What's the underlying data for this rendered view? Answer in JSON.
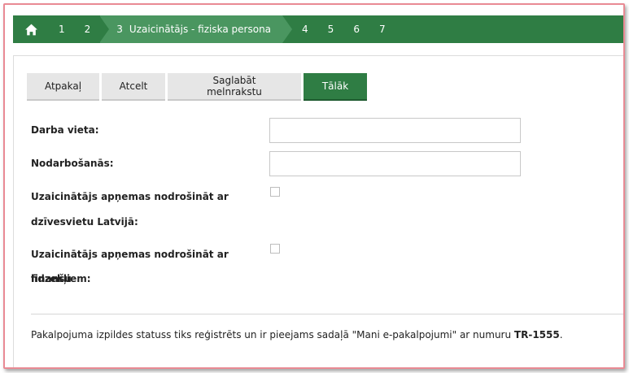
{
  "steps": {
    "home_icon": "home-icon",
    "items": [
      {
        "number": "1",
        "label": ""
      },
      {
        "number": "2",
        "label": ""
      },
      {
        "number": "3",
        "label": "Uzaicinātājs - fiziska persona"
      },
      {
        "number": "4",
        "label": ""
      },
      {
        "number": "5",
        "label": ""
      },
      {
        "number": "6",
        "label": ""
      },
      {
        "number": "7",
        "label": ""
      }
    ],
    "active_index": 2
  },
  "toolbar": {
    "back_label": "Atpakaļ",
    "cancel_label": "Atcelt",
    "save_draft_label": "Saglabāt melnrakstu",
    "next_label": "Tālāk"
  },
  "form": {
    "workplace_label": "Darba vieta:",
    "workplace_value": "",
    "occupation_label": "Nodarbošanās:",
    "occupation_value": "",
    "residence_line1": "Uzaicinātājs apņemas nodrošināt ar",
    "residence_line2": "dzīvesvietu Latvijā:",
    "residence_checked": false,
    "finance_line1": "Uzaicinātājs apņemas nodrošināt ar finanšu",
    "finance_line2": "līdzekļiem:",
    "finance_checked": false
  },
  "footer": {
    "note_text": "Pakalpojuma izpildes statuss tiks reģistrēts un ir pieejams sadaļā \"Mani e-pakalpojumi\" ar numuru ",
    "reference_number": "TR-1555",
    "note_end": "."
  },
  "colors": {
    "brand_green": "#2f7d44",
    "active_step": "#4a9660",
    "frame_border": "#e98a94"
  }
}
